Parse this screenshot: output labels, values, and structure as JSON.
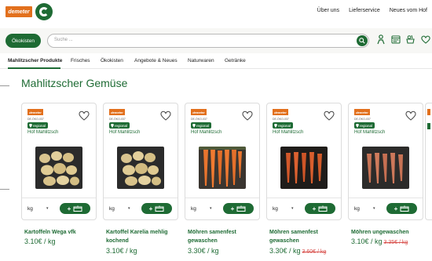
{
  "brand": {
    "demeter_logo": "demeter"
  },
  "topnav": [
    "Über uns",
    "Lieferservice",
    "Neues vom Hof"
  ],
  "search": {
    "button_label": "Ökokisten",
    "placeholder": "Suche ..."
  },
  "icons": [
    "person-icon",
    "calendar-icon",
    "vegetable-basket-icon",
    "heart-icon"
  ],
  "categories": [
    "Mahlitzscher Produkte",
    "Frisches",
    "Ökokisten",
    "Angebote & Neues",
    "Naturwaren",
    "Getränke"
  ],
  "section_title": "Mahlitzscher Gemüse",
  "colors": {
    "brand_green": "#1e6b34",
    "demeter_orange": "#e2701d",
    "strike_red": "#d9534f"
  },
  "products": [
    {
      "badge": "demeter",
      "code": "DE-ÖKO-037",
      "tag": "regional",
      "farm": "Hof Mahlitzsch",
      "unit": "kg",
      "name": "Kartoffeln Wega vfk",
      "price": "3.10€ / kg",
      "old_price": ""
    },
    {
      "badge": "demeter",
      "code": "DE-ÖKO-037",
      "tag": "regional",
      "farm": "Hof Mahlitzsch",
      "unit": "kg",
      "name": "Kartoffel Karelia mehlig kochend",
      "price": "3.10€ / kg",
      "old_price": ""
    },
    {
      "badge": "demeter",
      "code": "DE-ÖKO-037",
      "tag": "regional",
      "farm": "Hof Mahlitzsch",
      "unit": "kg",
      "name": "Möhren samenfest gewaschen",
      "price": "3.30€ / kg",
      "old_price": ""
    },
    {
      "badge": "demeter",
      "code": "DE-ÖKO-037",
      "tag": "regional",
      "farm": "Hof Mahlitzsch",
      "unit": "kg",
      "name": "Möhren samenfest gewaschen",
      "price": "3.30€ / kg",
      "old_price": "3.60€ / kg"
    },
    {
      "badge": "demeter",
      "code": "DE-ÖKO-037",
      "tag": "regional",
      "farm": "Hof Mahlitzsch",
      "unit": "kg",
      "name": "Möhren ungewaschen",
      "price": "3.10€ / kg",
      "old_price": "3.35€ / kg"
    }
  ]
}
